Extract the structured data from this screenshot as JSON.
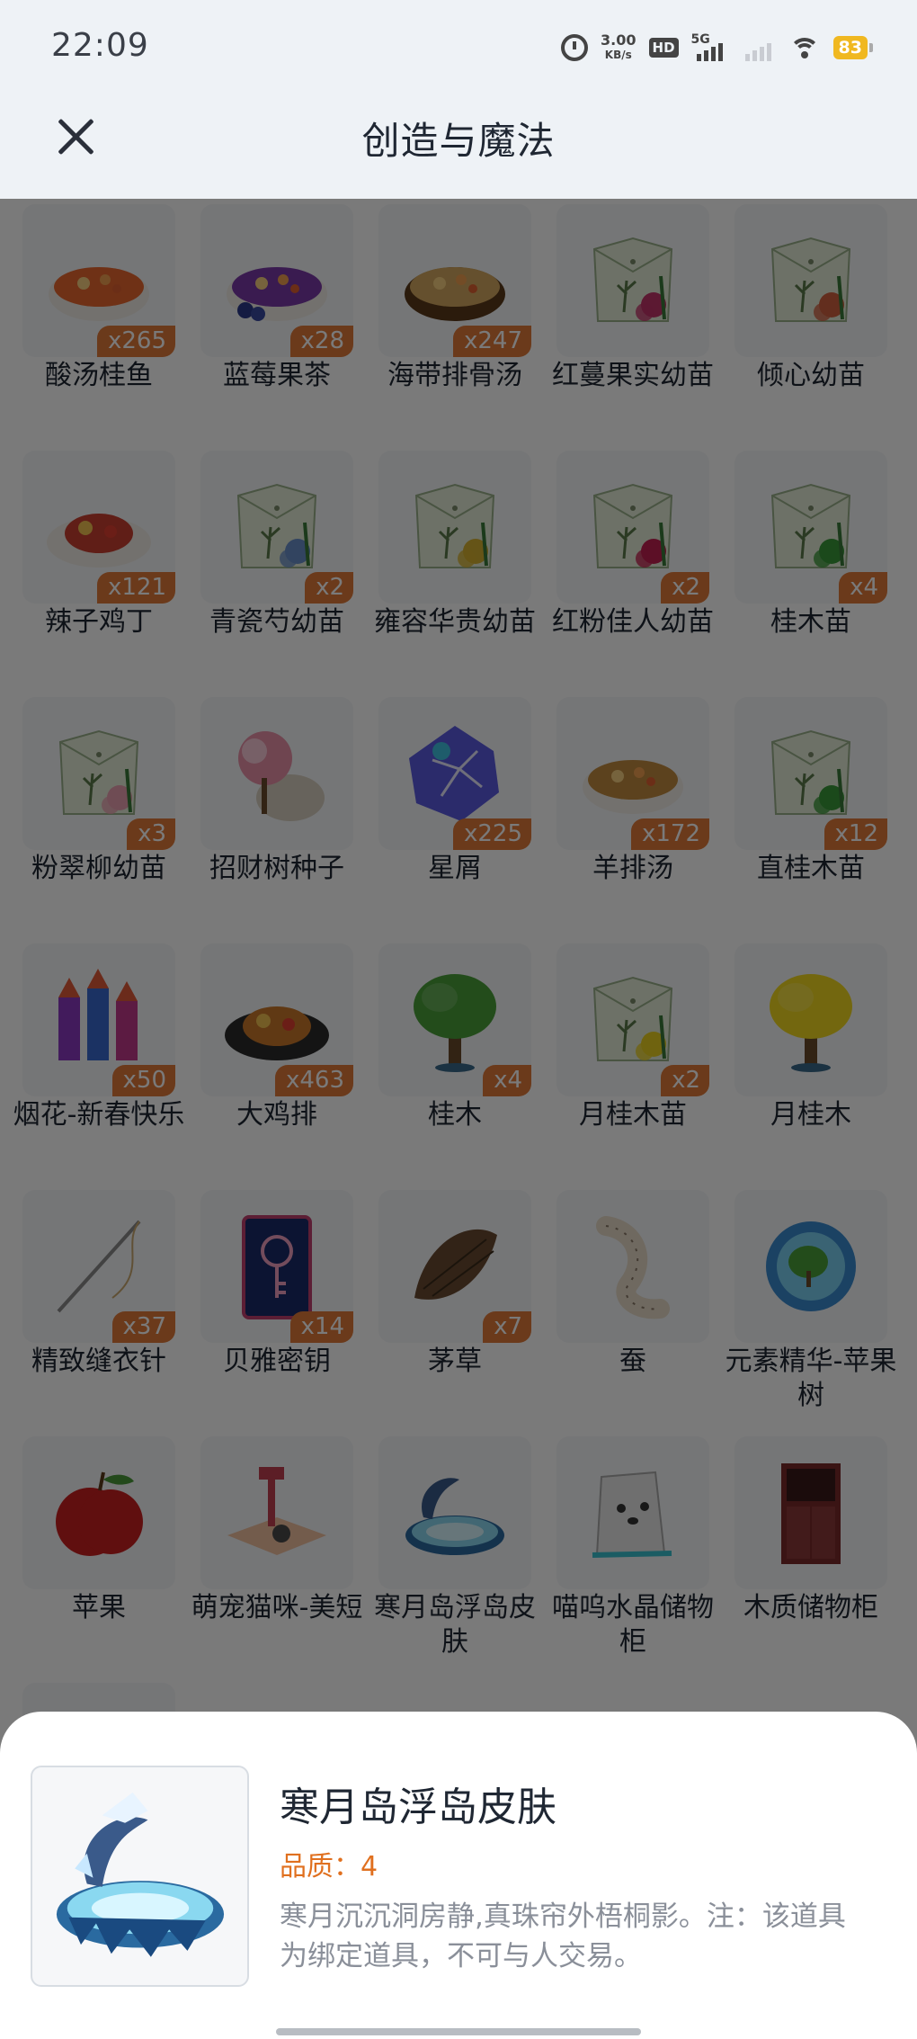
{
  "status_bar": {
    "time": "22:09",
    "speed_value": "3.00",
    "speed_unit": "KB/s",
    "hd": "HD",
    "network": "5G",
    "battery": "83"
  },
  "header": {
    "title": "创造与魔法"
  },
  "items": [
    {
      "name": "酸汤桂鱼",
      "qty": "x265",
      "icon": "fish-soup",
      "color": "#e8672f"
    },
    {
      "name": "蓝莓果茶",
      "qty": "x28",
      "icon": "blueberry-tea",
      "color": "#7a3aa8"
    },
    {
      "name": "海带排骨汤",
      "qty": "x247",
      "icon": "kelp-soup",
      "color": "#d4a860"
    },
    {
      "name": "红蔓果实幼苗",
      "qty": "",
      "icon": "seed-pack",
      "color": "#c0356a"
    },
    {
      "name": "倾心幼苗",
      "qty": "",
      "icon": "seed-pack",
      "color": "#d06040"
    },
    {
      "name": "辣子鸡丁",
      "qty": "x121",
      "icon": "spicy-chicken",
      "color": "#c84030"
    },
    {
      "name": "青瓷芍幼苗",
      "qty": "x2",
      "icon": "seed-pack",
      "color": "#6a8ec8"
    },
    {
      "name": "雍容华贵幼苗",
      "qty": "",
      "icon": "seed-pack",
      "color": "#d4b030"
    },
    {
      "name": "红粉佳人幼苗",
      "qty": "x2",
      "icon": "seed-pack",
      "color": "#c02050"
    },
    {
      "name": "桂木苗",
      "qty": "x4",
      "icon": "seed-pack",
      "color": "#3a9a3a"
    },
    {
      "name": "粉翠柳幼苗",
      "qty": "x3",
      "icon": "seed-pack",
      "color": "#e8a0b0"
    },
    {
      "name": "招财树种子",
      "qty": "",
      "icon": "fortune-seed",
      "color": "#e890a8"
    },
    {
      "name": "星屑",
      "qty": "x225",
      "icon": "stardust",
      "color": "#5a5ae0"
    },
    {
      "name": "羊排汤",
      "qty": "x172",
      "icon": "lamb-soup",
      "color": "#c08a40"
    },
    {
      "name": "直桂木苗",
      "qty": "x12",
      "icon": "seed-pack",
      "color": "#3a9a3a"
    },
    {
      "name": "烟花-新春快乐",
      "qty": "x50",
      "icon": "firework",
      "color": "#9a40c0"
    },
    {
      "name": "大鸡排",
      "qty": "x463",
      "icon": "chicken-cutlet",
      "color": "#c8782a"
    },
    {
      "name": "桂木",
      "qty": "x4",
      "icon": "tree",
      "color": "#4aa03a"
    },
    {
      "name": "月桂木苗",
      "qty": "x2",
      "icon": "seed-pack",
      "color": "#e8d020"
    },
    {
      "name": "月桂木",
      "qty": "",
      "icon": "tree",
      "color": "#f0d820"
    },
    {
      "name": "精致缝衣针",
      "qty": "x37",
      "icon": "needle",
      "color": "#8a7a6a"
    },
    {
      "name": "贝雅密钥",
      "qty": "x14",
      "icon": "key-card",
      "color": "#3a5ac0"
    },
    {
      "name": "茅草",
      "qty": "x7",
      "icon": "thatch",
      "color": "#6a4a30"
    },
    {
      "name": "蚕",
      "qty": "",
      "icon": "silkworm",
      "color": "#e0d0c0"
    },
    {
      "name": "元素精华-苹果树",
      "qty": "",
      "icon": "essence-orb",
      "color": "#3a8ad0"
    },
    {
      "name": "苹果",
      "qty": "",
      "icon": "apple",
      "color": "#c82020"
    },
    {
      "name": "萌宠猫咪-美短",
      "qty": "",
      "icon": "cat-bed",
      "color": "#f0a0a0"
    },
    {
      "name": "寒月岛浮岛皮肤",
      "qty": "",
      "icon": "island",
      "color": "#5ab0e0"
    },
    {
      "name": "喵呜水晶储物柜",
      "qty": "",
      "icon": "cat-cabinet",
      "color": "#e8e8e8"
    },
    {
      "name": "木质储物柜",
      "qty": "",
      "icon": "cabinet",
      "color": "#7a2a2a"
    },
    {
      "name": "",
      "qty": "",
      "icon": "partial-item",
      "color": "#888888"
    }
  ],
  "detail": {
    "title": "寒月岛浮岛皮肤",
    "quality": "品质：4",
    "description": "寒月沉沉洞房静,真珠帘外梧桐影。注：该道具为绑定道具，不可与人交易。",
    "icon": "island"
  }
}
